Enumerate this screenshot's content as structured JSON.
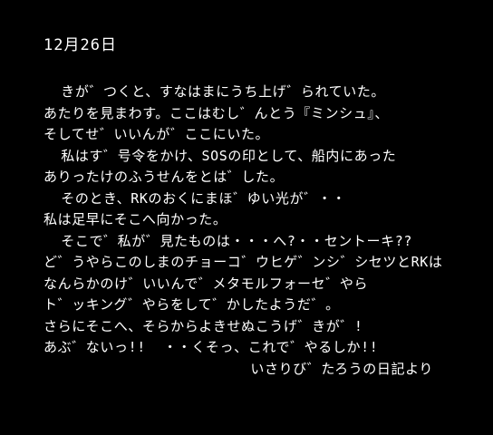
{
  "screen": {
    "background_color": "#000000",
    "text_color": "#ffffff"
  },
  "diary": {
    "date": "12月26日",
    "lines": [
      "  きが゛つくと、すなはまにうち上げ゛られていた。",
      "あたりを見まわす。ここはむし゛んとう『ミンシュ』、",
      "そしてせ゛いいんが゛ここにいた。",
      "  私はす゛号令をかけ、SOSの印として、船内にあった",
      "ありったけのふうせんをとは゛した。",
      "  そのとき、RKのおくにまほ゛ゆい光が゛・・",
      "私は足早にそこへ向かった。",
      "  そこで゛私が゛見たものは・・・へ?・・セントーキ??",
      "ど゛うやらこのしまのチョーコ゛ウヒゲ゛ンシ゛シセツとRKは",
      "なんらかのけ゛いいんで゛メタモルフォーセ゛やら",
      "ト゛ッキング゛やらをして゛かしたようだ゛。",
      "さらにそこへ、そらからよきせぬこうげ゛きが゛!",
      "あぶ゛ないっ!!  ・・くそっ、これで゛やるしか!!"
    ],
    "signature": "いさりび゛たろうの日記より"
  }
}
